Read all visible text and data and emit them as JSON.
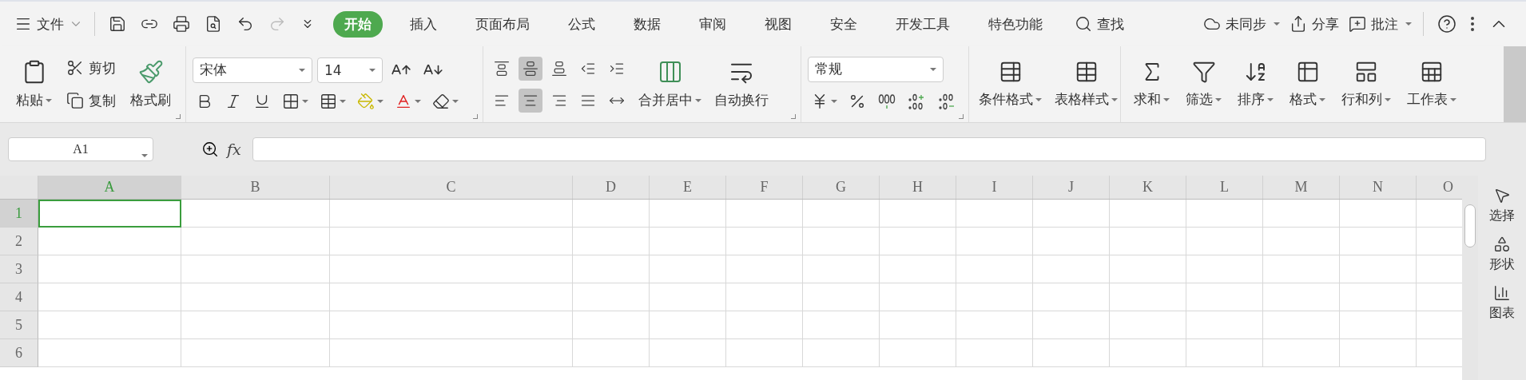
{
  "menu": {
    "label": "文件"
  },
  "tabs": [
    {
      "label": "开始",
      "selected": true
    },
    {
      "label": "插入",
      "selected": false
    },
    {
      "label": "页面布局",
      "selected": false
    },
    {
      "label": "公式",
      "selected": false
    },
    {
      "label": "数据",
      "selected": false
    },
    {
      "label": "审阅",
      "selected": false
    },
    {
      "label": "视图",
      "selected": false
    },
    {
      "label": "安全",
      "selected": false
    },
    {
      "label": "开发工具",
      "selected": false
    },
    {
      "label": "特色功能",
      "selected": false
    }
  ],
  "search": {
    "label": "查找"
  },
  "actions": [
    {
      "kind": "sync",
      "label": "未同步",
      "dropdown": true
    },
    {
      "kind": "share",
      "label": "分享",
      "dropdown": false
    },
    {
      "kind": "comment",
      "label": "批注",
      "dropdown": true
    }
  ],
  "clipboard": {
    "paste": "粘贴",
    "cut": "剪切",
    "copy": "复制",
    "painter": "格式刷"
  },
  "font": {
    "name": "宋体",
    "size": "14"
  },
  "align_buttons": [
    {
      "selected": false
    },
    {
      "selected": true
    },
    {
      "selected": false
    },
    {
      "selected": false
    },
    {
      "selected": false
    },
    {
      "selected": false
    },
    {
      "selected": true
    },
    {
      "selected": false
    },
    {
      "selected": false
    },
    {
      "selected": false
    }
  ],
  "merge": {
    "merge_label": "合并居中",
    "wrap_label": "自动换行"
  },
  "number_format": {
    "value": "常规"
  },
  "style_buttons": [
    {
      "kind": "conditional",
      "label": "条件格式"
    },
    {
      "kind": "table",
      "label": "表格样式"
    }
  ],
  "cell_buttons": [
    {
      "kind": "sum",
      "label": "求和"
    },
    {
      "kind": "filter",
      "label": "筛选"
    },
    {
      "kind": "sort",
      "label": "排序"
    },
    {
      "kind": "format",
      "label": "格式"
    },
    {
      "kind": "rowcol",
      "label": "行和列"
    },
    {
      "kind": "sheet",
      "label": "工作表"
    }
  ],
  "formula_bar": {
    "cell_ref": "A1",
    "fx_label": "fx"
  },
  "sheet": {
    "columns": [
      {
        "label": "A",
        "selected": true
      },
      {
        "label": "B",
        "selected": false
      },
      {
        "label": "C",
        "selected": false
      },
      {
        "label": "D",
        "selected": false
      },
      {
        "label": "E",
        "selected": false
      },
      {
        "label": "F",
        "selected": false
      },
      {
        "label": "G",
        "selected": false
      },
      {
        "label": "H",
        "selected": false
      },
      {
        "label": "I",
        "selected": false
      },
      {
        "label": "J",
        "selected": false
      },
      {
        "label": "K",
        "selected": false
      },
      {
        "label": "L",
        "selected": false
      },
      {
        "label": "M",
        "selected": false
      },
      {
        "label": "N",
        "selected": false
      },
      {
        "label": "O",
        "selected": false
      }
    ],
    "rows": [
      {
        "label": "1",
        "selected": true
      },
      {
        "label": "2",
        "selected": false
      },
      {
        "label": "3",
        "selected": false
      },
      {
        "label": "4",
        "selected": false
      },
      {
        "label": "5",
        "selected": false
      },
      {
        "label": "6",
        "selected": false
      }
    ]
  },
  "side_panel": [
    {
      "kind": "select",
      "label": "选择"
    },
    {
      "kind": "shape",
      "label": "形状"
    },
    {
      "kind": "chart",
      "label": "图表"
    }
  ]
}
